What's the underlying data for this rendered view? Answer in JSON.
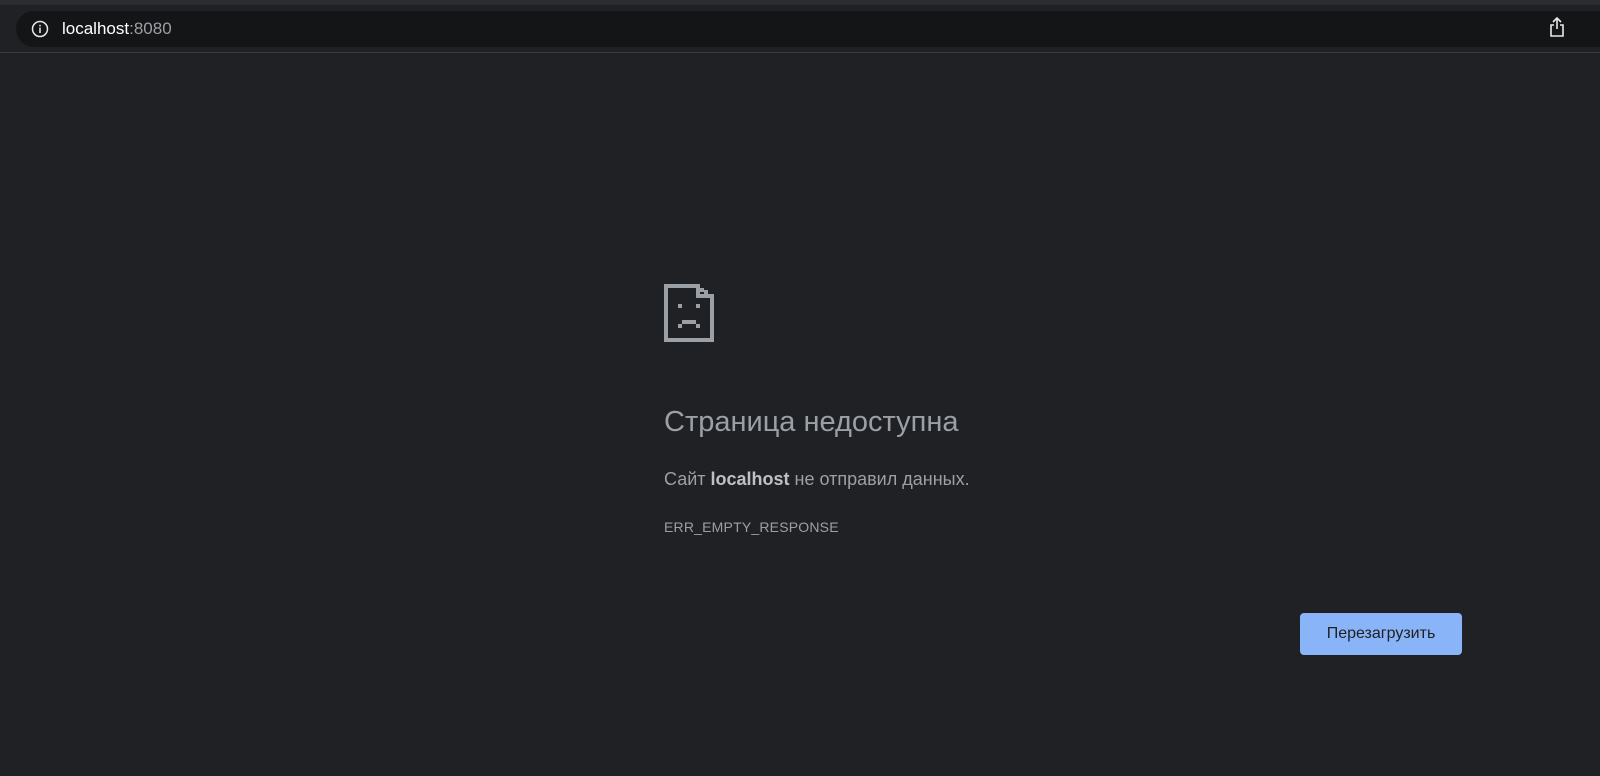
{
  "address_bar": {
    "host": "localhost",
    "port": ":8080",
    "info_icon": "info-circle-icon",
    "share_icon": "share-icon"
  },
  "error_page": {
    "icon": "sad-page-icon",
    "heading": "Страница недоступна",
    "summary_before": "Сайт ",
    "summary_host": "localhost",
    "summary_after": " не отправил данных.",
    "error_code": "ERR_EMPTY_RESPONSE",
    "reload_label": "Перезагрузить"
  },
  "colors": {
    "background": "#202124",
    "text": "#9aa0a6",
    "button": "#8ab4f8"
  }
}
